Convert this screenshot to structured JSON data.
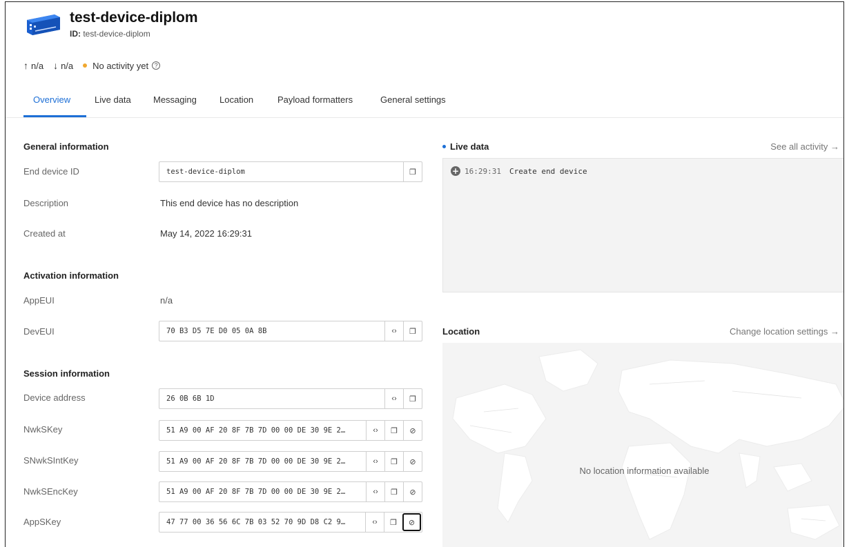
{
  "device": {
    "title": "test-device-diplom",
    "id_label": "ID:",
    "id_value": "test-device-diplom"
  },
  "stats": {
    "uplink": "n/a",
    "downlink": "n/a",
    "activity": "No activity yet",
    "status_color": "#f0a830"
  },
  "tabs": [
    {
      "label": "Overview",
      "active": true
    },
    {
      "label": "Live data"
    },
    {
      "label": "Messaging"
    },
    {
      "label": "Location"
    },
    {
      "label": "Payload formatters"
    },
    {
      "label": "General settings"
    }
  ],
  "general": {
    "heading": "General information",
    "end_device_id_label": "End device ID",
    "end_device_id": "test-device-diplom",
    "description_label": "Description",
    "description": "This end device has no description",
    "created_label": "Created at",
    "created": "May 14, 2022 16:29:31"
  },
  "activation": {
    "heading": "Activation information",
    "appeui_label": "AppEUI",
    "appeui": "n/a",
    "deveui_label": "DevEUI",
    "deveui": "70 B3 D5 7E D0 05 0A 8B"
  },
  "session": {
    "heading": "Session information",
    "devaddr_label": "Device address",
    "devaddr": "26 0B 6B 1D",
    "nwkskey_label": "NwkSKey",
    "nwkskey": "51 A9 00 AF 20 8F 7B 7D 00 00 DE 30 9E 2…",
    "snwksintkey_label": "SNwkSIntKey",
    "snwksintkey": "51 A9 00 AF 20 8F 7B 7D 00 00 DE 30 9E 2…",
    "nwksenckey_label": "NwkSEncKey",
    "nwksenckey": "51 A9 00 AF 20 8F 7B 7D 00 00 DE 30 9E 2…",
    "appskey_label": "AppSKey",
    "appskey": "47 77 00 36 56 6C 7B 03 52 70 9D D8 C2 9…"
  },
  "live": {
    "heading": "Live data",
    "see_all": "See all activity →",
    "events": [
      {
        "time": "16:29:31",
        "text": "Create end device"
      }
    ]
  },
  "location": {
    "heading": "Location",
    "change_link": "Change location settings →",
    "empty_message": "No location information available"
  },
  "colors": {
    "accent": "#1d6fd6"
  }
}
